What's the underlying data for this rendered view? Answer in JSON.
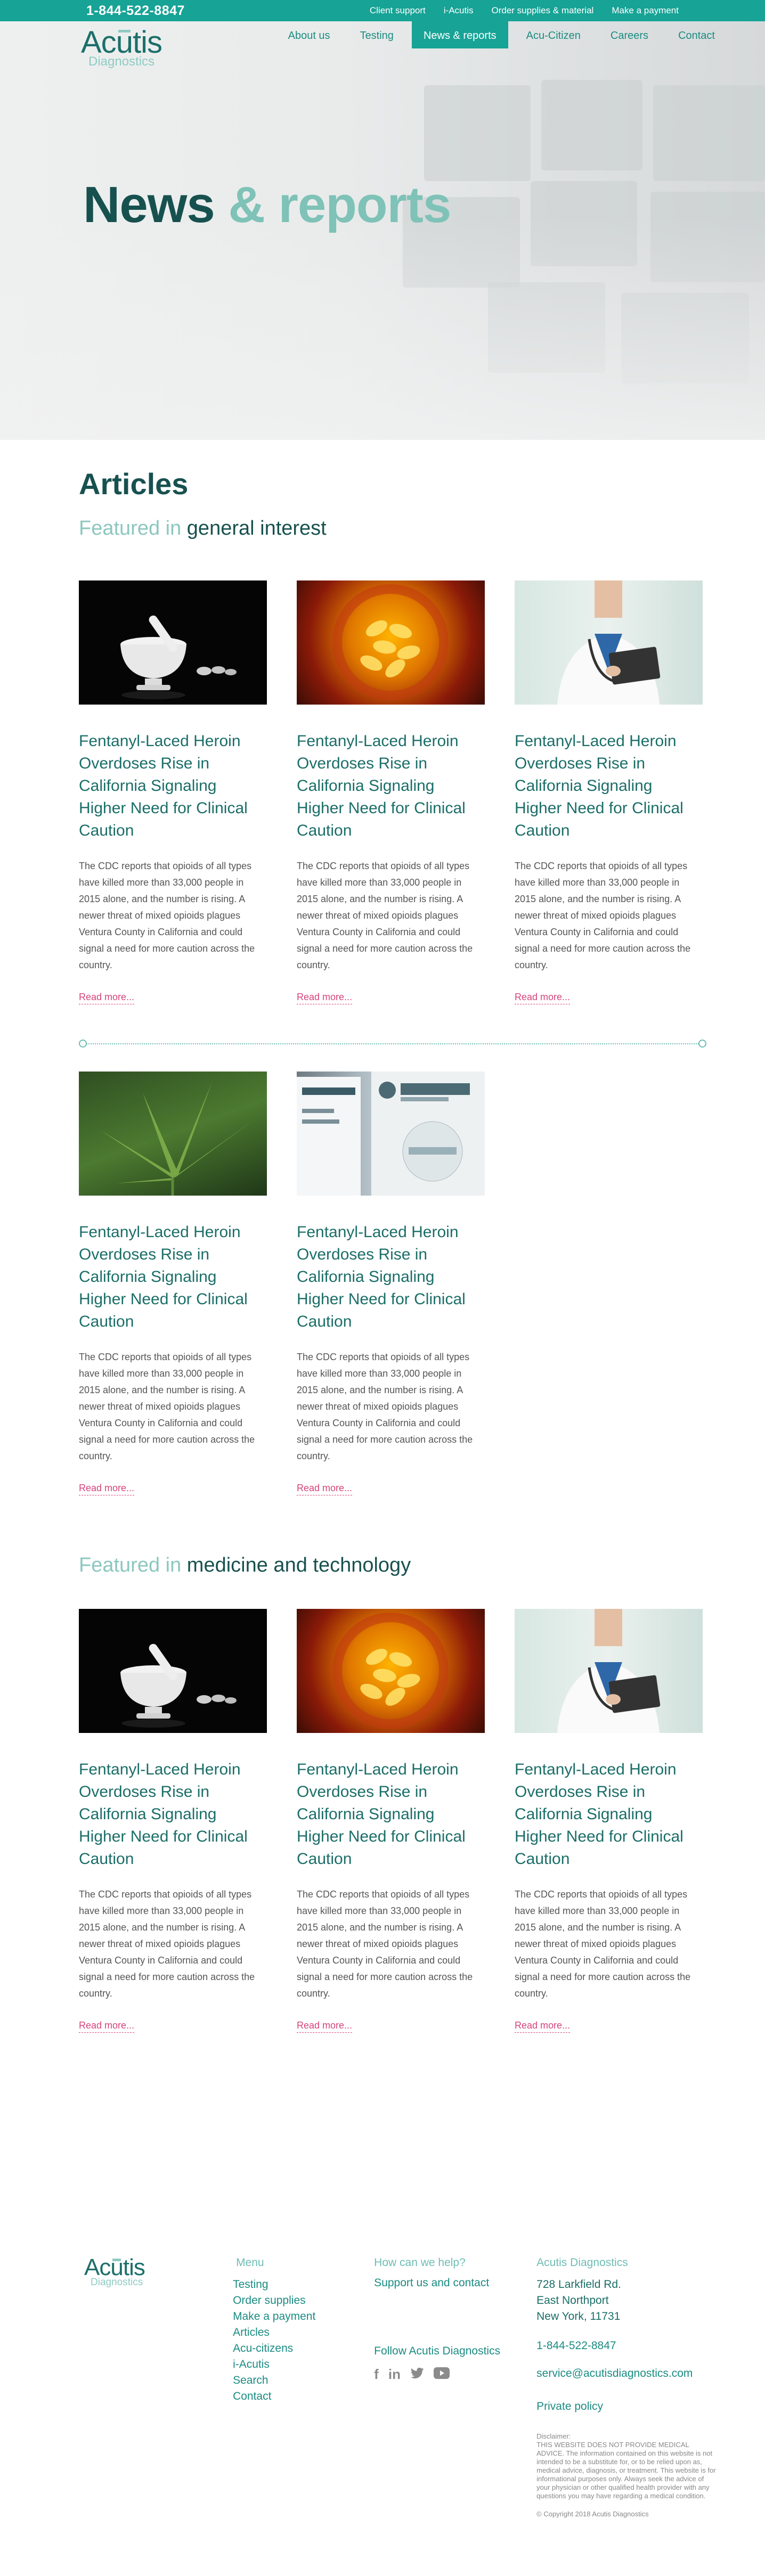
{
  "topbar": {
    "phone": "1-844-522-8847",
    "links": [
      "Client support",
      "i-Acutis",
      "Order supplies & material",
      "Make a payment"
    ]
  },
  "brand": {
    "name": "Acutis",
    "sub": "Diagnostics"
  },
  "nav": {
    "items": [
      {
        "label": "About us",
        "active": false
      },
      {
        "label": "Testing",
        "active": false
      },
      {
        "label": "News & reports",
        "active": true
      },
      {
        "label": "Acu-Citizen",
        "active": false
      },
      {
        "label": "Careers",
        "active": false
      },
      {
        "label": "Contact",
        "active": false
      }
    ]
  },
  "hero": {
    "title_a": "News",
    "title_b": "& reports"
  },
  "articles": {
    "title": "Articles",
    "featured_label": "Featured in",
    "section1": {
      "category": "general interest",
      "row1": [
        {
          "image": "mortar-pestle-image",
          "title": "Fentanyl-Laced Heroin Overdoses Rise in California Signaling Higher Need for Clinical Caution",
          "body": "The CDC reports that opioids of all types have killed more than 33,000 people in 2015 alone, and the number is rising. A newer threat of mixed opioids plagues Ventura County in California and could signal a need for more caution across the country.",
          "more": "Read more..."
        },
        {
          "image": "pills-image",
          "title": "Fentanyl-Laced Heroin Overdoses Rise in California Signaling Higher Need for Clinical Caution",
          "body": "The CDC reports that opioids of all types have killed more than 33,000 people in 2015 alone, and the number is rising. A newer threat of mixed opioids plagues Ventura County in California and could signal a need for more caution across the country.",
          "more": "Read more..."
        },
        {
          "image": "doctor-image",
          "title": "Fentanyl-Laced Heroin Overdoses Rise in California Signaling Higher Need for Clinical Caution",
          "body": "The CDC reports that opioids of all types have killed more than 33,000 people in 2015 alone, and the number is rising. A newer threat of mixed opioids plagues Ventura County in California and could signal a need for more caution across the country.",
          "more": "Read more..."
        }
      ],
      "row2": [
        {
          "image": "cannabis-leaf-image",
          "title": "Fentanyl-Laced Heroin Overdoses Rise in California Signaling Higher Need for Clinical Caution",
          "body": "The CDC reports that opioids of all types have killed more than 33,000 people in 2015 alone, and the number is rising. A newer threat of mixed opioids plagues Ventura County in California and could signal a need for more caution across the country.",
          "more": "Read more..."
        },
        {
          "image": "acutis-booth-image",
          "title": "Fentanyl-Laced Heroin Overdoses Rise in California Signaling Higher Need for Clinical Caution",
          "body": "The CDC reports that opioids of all types have killed more than 33,000 people in 2015 alone, and the number is rising. A newer threat of mixed opioids plagues Ventura County in California and could signal a need for more caution across the country.",
          "more": "Read more..."
        }
      ]
    },
    "section2": {
      "category": "medicine and technology",
      "row1": [
        {
          "image": "mortar-pestle-image",
          "title": "Fentanyl-Laced Heroin Overdoses Rise in California Signaling Higher Need for Clinical Caution",
          "body": "The CDC reports that opioids of all types have killed more than 33,000 people in 2015 alone, and the number is rising. A newer threat of mixed opioids plagues Ventura County in California and could signal a need for more caution across the country.",
          "more": "Read more..."
        },
        {
          "image": "pills-image",
          "title": "Fentanyl-Laced Heroin Overdoses Rise in California Signaling Higher Need for Clinical Caution",
          "body": "The CDC reports that opioids of all types have killed more than 33,000 people in 2015 alone, and the number is rising. A newer threat of mixed opioids plagues Ventura County in California and could signal a need for more caution across the country.",
          "more": "Read more..."
        },
        {
          "image": "doctor-image",
          "title": "Fentanyl-Laced Heroin Overdoses Rise in California Signaling Higher Need for Clinical Caution",
          "body": "The CDC reports that opioids of all types have killed more than 33,000 people in 2015 alone, and the number is rising. A newer threat of mixed opioids plagues Ventura County in California and could signal a need for more caution across the country.",
          "more": "Read more..."
        }
      ]
    }
  },
  "footer": {
    "menu_heading": "Menu",
    "menu": [
      "Testing",
      "Order supplies",
      "Make a payment",
      "Articles",
      "Acu-citizens",
      "i-Acutis",
      "Search",
      "Contact"
    ],
    "help_heading": "How can we help?",
    "support_link": "Support us and contact",
    "follow": "Follow Acutis Diagnostics",
    "social_icons": [
      "facebook-icon",
      "linkedin-icon",
      "twitter-icon",
      "youtube-icon"
    ],
    "contact_heading": "Acutis Diagnostics",
    "address": [
      "728 Larkfield Rd.",
      "East Northport",
      "New York, 11731"
    ],
    "phone": "1-844-522-8847",
    "email": "service@acutisdiagnostics.com",
    "privacy": "Private policy",
    "disclaimer_title": "Disclaimer:",
    "disclaimer": "THIS WEBSITE DOES NOT PROVIDE MEDICAL ADVICE. The information contained on this website is not intended to be a substitute for, or to be relied upon as, medical advice, diagnosis, or treatment. This website is for informational purposes only. Always seek the advice of your physician or other qualified health provider with any questions you may have regarding a medical condition.",
    "copyright": "© Copyright 2018 Acutis Diagnostics"
  },
  "colors": {
    "teal": "#17a396",
    "dark_teal": "#17514f",
    "light_teal": "#8cc7bf",
    "link_pink": "#d6437a"
  }
}
